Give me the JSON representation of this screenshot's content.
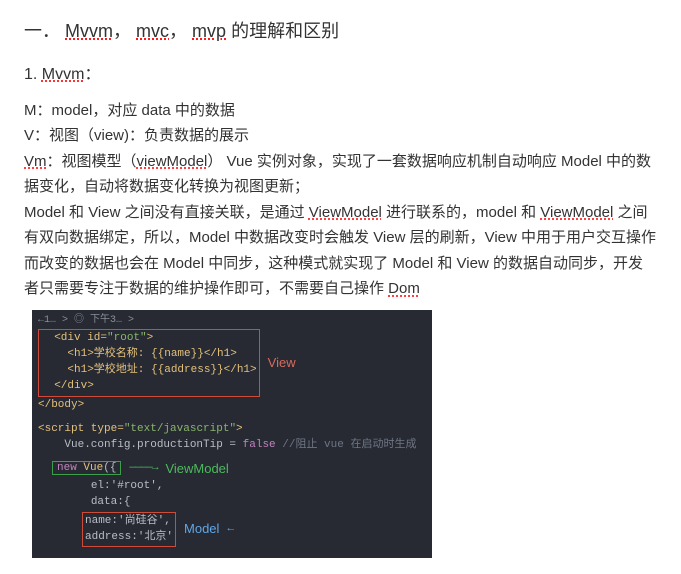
{
  "title": {
    "prefix": "一．",
    "w1": "Mvvm",
    "sep1": "，",
    "w2": "mvc",
    "sep2": "，",
    "w3": "mvp",
    "suffix": " 的理解和区别"
  },
  "section1": {
    "num": "1.",
    "name": "Mvvm",
    "colon": "："
  },
  "lines": {
    "m": "M：model，对应 data 中的数据",
    "v": "V：视图（view)：负责数据的展示",
    "vm_u1": "Vm",
    "vm_a": "：视图模型（",
    "vm_u2": "viewModel",
    "vm_b": "）  Vue 实例对象，实现了一套数据响应机制自动响应 Model 中的数据变化，自动将数据变化转换为视图更新；",
    "p2a": "Model 和 View 之间没有直接关联，是通过 ",
    "p2u": "ViewModel",
    "p2b": " 进行联系的，model 和 ",
    "p2u2": "ViewModel",
    "p2c": " 之间有双向数据绑定，所以，Model 中数据改变时会触发 View 层的刷新，View 中用于用户交互操作而改变的数据也会在 Model 中同步，这种模式就实现了 Model 和 View 的数据自动同步，开发者只需要专注于数据的维护操作即可，不需要自己操作 ",
    "p2u3": "Dom"
  },
  "code": {
    "crumb": "←1… > ◎ 下午3… >",
    "l1a": "<div id=",
    "l1b": "\"root\"",
    "l1c": ">",
    "l2": "<h1>学校名称: {{name}}</h1>",
    "l3": "<h1>学校地址: {{address}}</h1>",
    "l4": "</div>",
    "l5": "</body>",
    "lblView": "View",
    "s1a": "<script type=",
    "s1b": "\"text/javascript\"",
    "s1c": ">",
    "s2a": "Vue.config.productionTip = ",
    "s2b": "false",
    "s2c": " //阻止 vue 在启动时生成",
    "nv": "new Vue({",
    "lblVm": "ViewModel",
    "arrowG": "————→",
    "el": "el:'#root',",
    "data": "data:{",
    "name": "name:'尚硅谷',",
    "addr": "address:'北京'",
    "lblModel": "Model",
    "arrowB": "←"
  }
}
